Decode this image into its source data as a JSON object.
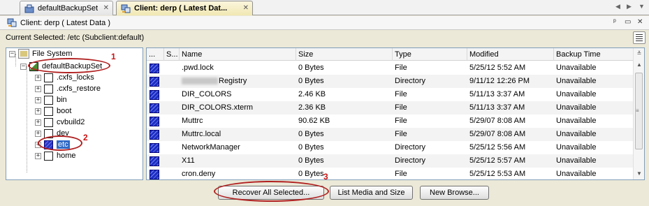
{
  "tabs": [
    {
      "label": "defaultBackupSet",
      "close": "✕"
    },
    {
      "label": "Client: derp ( Latest Dat...",
      "close": "✕"
    }
  ],
  "tab_nav": {
    "prev": "◀",
    "next": "▶",
    "menu": "▼"
  },
  "panel": {
    "title": "Client: derp ( Latest Data )",
    "pin": "ᵖ",
    "restore": "▭",
    "close": "✕"
  },
  "current_selected": "Current Selected: /etc (Subclient:default)",
  "tree": {
    "root": "File System",
    "backupset": "defaultBackupSet",
    "items": [
      ".cxfs_locks",
      ".cxfs_restore",
      "bin",
      "boot",
      "cvbuild2",
      "dev",
      "etc",
      "home"
    ],
    "selected": "etc"
  },
  "table": {
    "headers": [
      "...",
      "S...",
      "Name",
      "Size",
      "Type",
      "Modified",
      "Backup Time"
    ],
    "rows": [
      {
        "name": ".pwd.lock",
        "size": "0 Bytes",
        "type": "File",
        "modified": "5/25/12 5:52 AM",
        "backup": "Unavailable"
      },
      {
        "name": "Registry",
        "size": "0 Bytes",
        "type": "Directory",
        "modified": "9/11/12 12:26 PM",
        "backup": "Unavailable"
      },
      {
        "name": "DIR_COLORS",
        "size": "2.46 KB",
        "type": "File",
        "modified": "5/11/13 3:37 AM",
        "backup": "Unavailable"
      },
      {
        "name": "DIR_COLORS.xterm",
        "size": "2.36 KB",
        "type": "File",
        "modified": "5/11/13 3:37 AM",
        "backup": "Unavailable"
      },
      {
        "name": "Muttrc",
        "size": "90.62 KB",
        "type": "File",
        "modified": "5/29/07 8:08 AM",
        "backup": "Unavailable"
      },
      {
        "name": "Muttrc.local",
        "size": "0 Bytes",
        "type": "File",
        "modified": "5/29/07 8:08 AM",
        "backup": "Unavailable"
      },
      {
        "name": "NetworkManager",
        "size": "0 Bytes",
        "type": "Directory",
        "modified": "5/25/12 5:56 AM",
        "backup": "Unavailable"
      },
      {
        "name": "X11",
        "size": "0 Bytes",
        "type": "Directory",
        "modified": "5/25/12 5:57 AM",
        "backup": "Unavailable"
      },
      {
        "name": "cron.deny",
        "size": "0 Bytes",
        "type": "File",
        "modified": "5/25/12 5:53 AM",
        "backup": "Unavailable"
      }
    ]
  },
  "buttons": {
    "recover": "Recover All Selected...",
    "list_media": "List Media and Size",
    "new_browse": "New Browse..."
  },
  "annotations": [
    "1",
    "2",
    "3"
  ],
  "colors": {
    "annotation": "#b02020",
    "selection": "#316ac5",
    "checked": "#2a34c8"
  }
}
